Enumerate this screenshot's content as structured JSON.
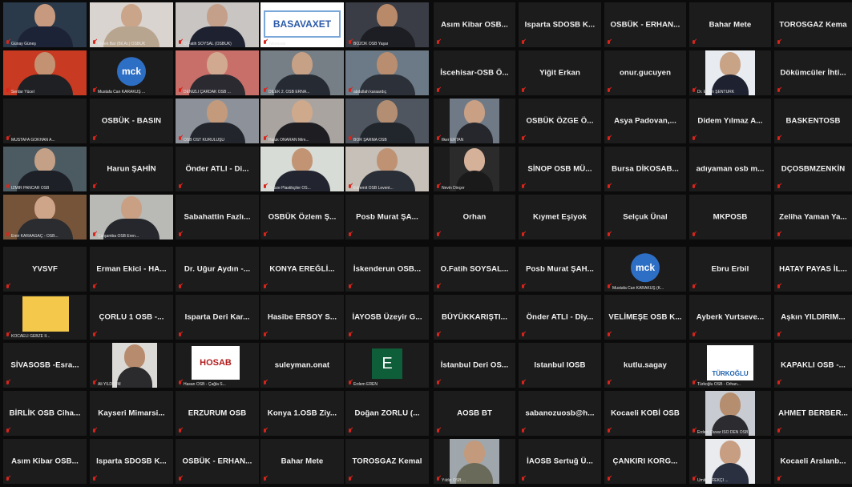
{
  "meeting": {
    "video_tiles": [
      {
        "name": "Günay Güneş",
        "caption": "Günay Güneş"
      },
      {
        "name": "Melek Bar",
        "caption": "Melek Bar (Bil.Ar.) OSBÜK"
      },
      {
        "name": "O.Fatih SOYSAL",
        "caption": "O.Fatih SOYSAL (OSBÜK)"
      },
      {
        "name": "Teknosab",
        "caption": "Teknosab",
        "logo_text": "BASAVAXET"
      },
      {
        "name": "BOZOK OSB Yaşar",
        "caption": "BOZOK OSB Yaşar"
      },
      {
        "name": "Serdar Yücel",
        "caption": "Serdar Yücel"
      },
      {
        "name": "Mustafa Can KARAKUŞ",
        "caption": "Mustafa Can KARAKUŞ ...",
        "avatar": "mck"
      },
      {
        "name": "DENİZLİ ÇARDAK OSB",
        "caption": "DENİZLİ ÇARDAK OSB ..."
      },
      {
        "name": "DİLEK 2. OSB ERNA",
        "caption": "DİLEK 2. OSB ERNA..."
      },
      {
        "name": "abdullah karaardıç",
        "caption": "abdullah karaardıç"
      },
      {
        "name": "MUSTAFA GÖKHAN A...",
        "caption": "MUSTAFA GÖKHAN A..."
      },
      {
        "name": "OSB OST KURULUŞU",
        "caption": "OSB OST KURULUŞU"
      },
      {
        "name": "Haluk ONARAN Mim...",
        "caption": "Haluk ONARAN Mim..."
      },
      {
        "name": "BOR ŞARMA OSB",
        "caption": "BOR ŞARMA OSB"
      },
      {
        "name": "İZMİR PANCAR OSB",
        "caption": "İZMİR PANCAR OSB"
      },
      {
        "name": "Gebze Plastikçiler OS...",
        "caption": "Gebze Plastikçiler OS..."
      },
      {
        "name": "Edremit OSB Levent",
        "caption": "Edremit OSB Levent..."
      },
      {
        "name": "Emir KARAAĞAÇ",
        "caption": "Emir KARAAĞAÇ - OSB..."
      },
      {
        "name": "Çarşamba OSB Eren",
        "caption": "Çarşamba OSB Eren..."
      }
    ],
    "name_tiles_left": [
      "OSBÜK - BASIN",
      "Harun ŞAHİN",
      "Önder ATLI - Di...",
      "Sabahattin Fazlı...",
      "OSBÜK Özlem Ş...",
      "Posb Murat ŞA...",
      "YVSVF",
      "Erman Ekici - HA...",
      "Dr. Uğur Aydın -...",
      "KONYA EREĞLİ...",
      "İskenderun OSB...",
      "ÇORLU 1 OSB -...",
      "Isparta Deri Kar...",
      "Hasibe ERSOY S...",
      "İAYOSB Üzeyir G...",
      "SİVASOSB -Esra...",
      "suleyman.onat",
      "BİRLİK OSB Ciha...",
      "Kayseri Mimarsi...",
      "ERZURUM OSB",
      "Konya 1.OSB Ziy...",
      "Doğan ZORLU (...",
      "Asım Kibar OSB...",
      "Isparta SDOSB K...",
      "OSBÜK - ERHAN...",
      "Bahar Mete",
      "TOROSGAZ Kemal"
    ],
    "small_captions_left": {
      "kocaeli": "KOCAELİ GEBZE II...",
      "ali": "Ali YILDIRIM",
      "hosab": "Hasan OSB - Çağla S...",
      "erdem": "Erdem EREN"
    },
    "avatar_letters": {
      "erdem": "E",
      "mck": "mck",
      "hosab": "HOSAB"
    },
    "name_tiles_right": [
      "Asım Kibar OSB...",
      "Isparta SDOSB K...",
      "OSBÜK - ERHAN...",
      "Bahar Mete",
      "TOROSGAZ Kema",
      "İscehisar-OSB Ö...",
      "Yiğit Erkan",
      "onur.gucuyen",
      "",
      "Dökümcüler İhti...",
      "",
      "OSBÜK ÖZGE Ö...",
      "Asya Padovan,...",
      "Didem Yılmaz A...",
      "BASKENTOSB",
      "",
      "SİNOP OSB MÜ...",
      "Bursa DİKOSAB...",
      "adıyaman osb m...",
      "DÇOSBMZENKİN",
      "Orhan",
      "Kıymet Eşiyok",
      "Selçuk Ünal",
      "MKPOSB",
      "Zeliha Yaman Ya...",
      "O.Fatih SOYSAL...",
      "Posb Murat ŞAH...",
      "",
      "Ebru Erbil",
      "HATAY PAYAS İL...",
      "BÜYÜKKARIŞTI...",
      "Önder ATLI - Diy...",
      "VELİMEŞE OSB K...",
      "Ayberk Yurtseve...",
      "Aşkın YILDIRIM...",
      "İstanbul Deri OS...",
      "Istanbul IOSB",
      "kutlu.sagay",
      "",
      "KAPAKLI OSB -...",
      "AOSB BT",
      "sabanozuosb@h...",
      "Kocaeli KOBİ OSB",
      "",
      "AHMET BERBER...",
      "",
      "İAOSB Sertuğ Ü...",
      "ÇANKIRI KORG...",
      "",
      "Kocaeli Arslanb..."
    ],
    "small_captions_right": {
      "ercan": "Dr. Ercan ŞENTÜRK",
      "ilker": "İlker ERTAN",
      "nevin": "Nevin Dinçer",
      "mck2": "Mustafa Can KARAKUŞ (K...",
      "turkoglu": "Türkoğlu OSB - Orhan...",
      "turkoglu_logo": "TÜRKOĞLU",
      "erdem2": "Erdem Duvar İSO DEN OSB...",
      "harbor": "Yıldız OSB ...",
      "man2": "Ümit TÜFEKÇİ ..."
    },
    "colors": {
      "tile": "#1c1c1c",
      "bg": "#0b0b0b",
      "mute": "#d9251b",
      "active": "#c8d63c",
      "mck": "#2e6fc6"
    }
  }
}
